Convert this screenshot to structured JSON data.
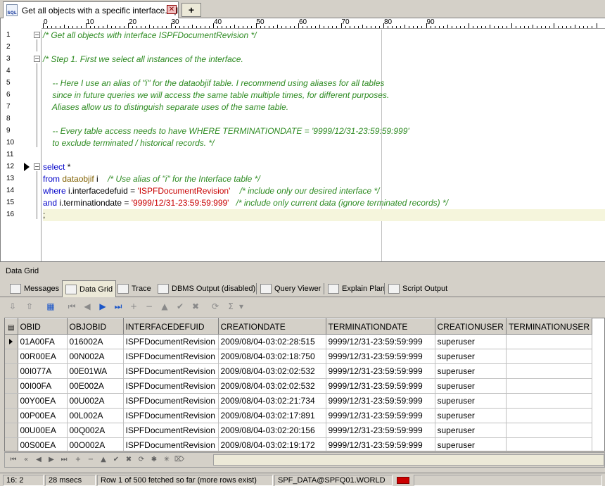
{
  "document_tab": {
    "title": "Get all objects with a specific interface.sql",
    "close_glyph": "✕",
    "add_glyph": "+"
  },
  "ruler": {
    "labels": [
      "0",
      "10",
      "20",
      "30",
      "40",
      "50",
      "60",
      "70",
      "80",
      "90"
    ]
  },
  "editor": {
    "line_numbers": [
      "1",
      "2",
      "3",
      "4",
      "5",
      "6",
      "7",
      "8",
      "9",
      "10",
      "11",
      "12",
      "13",
      "14",
      "15",
      "16"
    ],
    "lines": [
      [
        {
          "c": "cm",
          "t": "/* Get all objects with interface ISPFDocumentRevision */"
        }
      ],
      [],
      [
        {
          "c": "cm",
          "t": "/* Step 1. First we select all instances of the interface."
        }
      ],
      [],
      [
        {
          "c": "cm",
          "t": "    -- Here I use an alias of \"i\" for the dataobjif table. I recommend using aliases for all tables"
        }
      ],
      [
        {
          "c": "cm",
          "t": "    since in future queries we will access the same table multiple times, for different purposes."
        }
      ],
      [
        {
          "c": "cm",
          "t": "    Aliases allow us to distinguish separate uses of the same table."
        }
      ],
      [],
      [
        {
          "c": "cm",
          "t": "    -- Every table access needs to have WHERE TERMINATIONDATE = '9999/12/31-23:59:59:999'"
        }
      ],
      [
        {
          "c": "cm",
          "t": "    to exclude terminated / historical records. */"
        }
      ],
      [],
      [
        {
          "c": "kw",
          "t": "select"
        },
        {
          "c": "pl",
          "t": " *"
        }
      ],
      [
        {
          "c": "kw",
          "t": "from"
        },
        {
          "c": "pl",
          "t": " "
        },
        {
          "c": "tb",
          "t": "dataobjif"
        },
        {
          "c": "pl",
          "t": " i    "
        },
        {
          "c": "cm",
          "t": "/* Use alias of \"i\" for the Interface table */"
        }
      ],
      [
        {
          "c": "kw",
          "t": "where"
        },
        {
          "c": "pl",
          "t": " i.interfacedefuid = "
        },
        {
          "c": "st",
          "t": "'ISPFDocumentRevision'"
        },
        {
          "c": "pl",
          "t": "    "
        },
        {
          "c": "cm",
          "t": "/* include only our desired interface */"
        }
      ],
      [
        {
          "c": "kw",
          "t": "and"
        },
        {
          "c": "pl",
          "t": " i.terminationdate = "
        },
        {
          "c": "st",
          "t": "'9999/12/31-23:59:59:999'"
        },
        {
          "c": "pl",
          "t": "   "
        },
        {
          "c": "cm",
          "t": "/* include only current data (ignore terminated records) */"
        }
      ],
      [
        {
          "c": "pl",
          "t": ";"
        }
      ]
    ]
  },
  "data_grid_label": "Data Grid",
  "subtabs": [
    "Messages",
    "Data Grid",
    "Trace",
    "DBMS Output (disabled)",
    "Query Viewer",
    "Explain Plan",
    "Script Output"
  ],
  "grid": {
    "columns": [
      "OBID",
      "OBJOBID",
      "INTERFACEDEFUID",
      "CREATIONDATE",
      "TERMINATIONDATE",
      "CREATIONUSER",
      "TERMINATIONUSER"
    ],
    "rows": [
      [
        "01A00FA",
        "016002A",
        "ISPFDocumentRevision",
        "2009/08/04-03:02:28:515",
        "9999/12/31-23:59:59:999",
        "superuser",
        ""
      ],
      [
        "00R00EA",
        "00N002A",
        "ISPFDocumentRevision",
        "2009/08/04-03:02:18:750",
        "9999/12/31-23:59:59:999",
        "superuser",
        ""
      ],
      [
        "00I077A",
        "00E01WA",
        "ISPFDocumentRevision",
        "2009/08/04-03:02:02:532",
        "9999/12/31-23:59:59:999",
        "superuser",
        ""
      ],
      [
        "00I00FA",
        "00E002A",
        "ISPFDocumentRevision",
        "2009/08/04-03:02:02:532",
        "9999/12/31-23:59:59:999",
        "superuser",
        ""
      ],
      [
        "00Y00EA",
        "00U002A",
        "ISPFDocumentRevision",
        "2009/08/04-03:02:21:734",
        "9999/12/31-23:59:59:999",
        "superuser",
        ""
      ],
      [
        "00P00EA",
        "00L002A",
        "ISPFDocumentRevision",
        "2009/08/04-03:02:17:891",
        "9999/12/31-23:59:59:999",
        "superuser",
        ""
      ],
      [
        "00U00EA",
        "00Q002A",
        "ISPFDocumentRevision",
        "2009/08/04-03:02:20:156",
        "9999/12/31-23:59:59:999",
        "superuser",
        ""
      ],
      [
        "00S00EA",
        "00O002A",
        "ISPFDocumentRevision",
        "2009/08/04-03:02:19:172",
        "9999/12/31-23:59:59:999",
        "superuser",
        ""
      ]
    ]
  },
  "status": {
    "cursor": "16:  2",
    "timing": "28 msecs",
    "fetch": "Row 1 of 500 fetched so far (more rows exist)",
    "connection": "SPF_DATA@SPFQ01.WORLD"
  },
  "colors": {
    "comment": "#2e8b22",
    "keyword": "#0000c8",
    "string": "#c80000",
    "table": "#806000"
  }
}
